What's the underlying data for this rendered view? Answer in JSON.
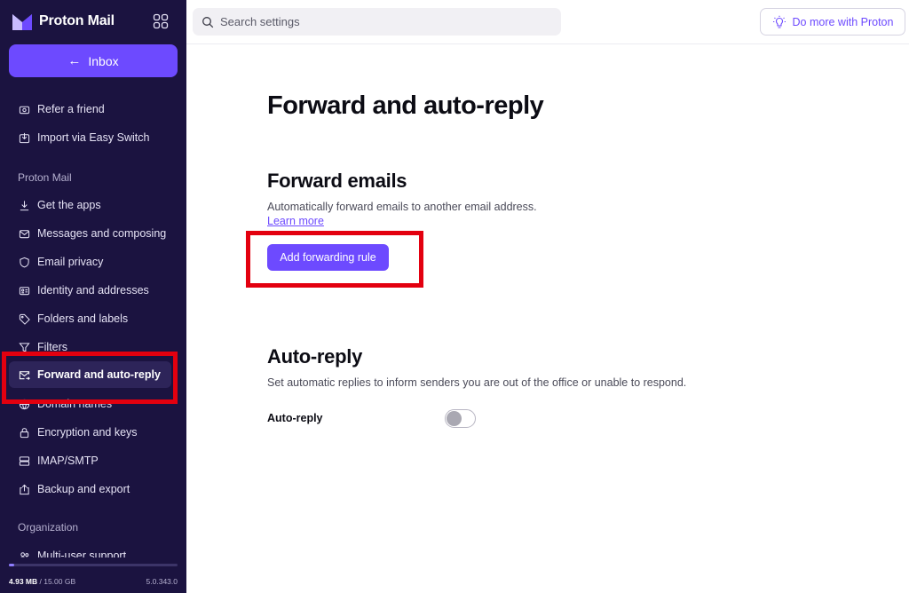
{
  "app": {
    "brand": "Proton Mail"
  },
  "sidebar": {
    "inbox_label": "Inbox",
    "items": [
      {
        "label": "Refer a friend",
        "icon": "gift-icon"
      },
      {
        "label": "Import via Easy Switch",
        "icon": "import-icon"
      }
    ],
    "section_mail": "Proton Mail",
    "mail_items": [
      {
        "label": "Get the apps",
        "icon": "download-icon"
      },
      {
        "label": "Messages and composing",
        "icon": "envelope-icon"
      },
      {
        "label": "Email privacy",
        "icon": "shield-icon"
      },
      {
        "label": "Identity and addresses",
        "icon": "id-card-icon"
      },
      {
        "label": "Folders and labels",
        "icon": "tag-icon"
      },
      {
        "label": "Filters",
        "icon": "filter-icon"
      },
      {
        "label": "Forward and auto-reply",
        "icon": "forward-envelope-icon",
        "active": true
      },
      {
        "label": "Domain names",
        "icon": "globe-icon"
      },
      {
        "label": "Encryption and keys",
        "icon": "lock-icon"
      },
      {
        "label": "IMAP/SMTP",
        "icon": "server-icon"
      },
      {
        "label": "Backup and export",
        "icon": "export-icon"
      }
    ],
    "section_org": "Organization",
    "org_items": [
      {
        "label": "Multi-user support",
        "icon": "users-icon"
      }
    ],
    "storage_used": "4.93 MB",
    "storage_total": "/ 15.00 GB",
    "storage_fraction": 0.003,
    "version": "5.0.343.0"
  },
  "topbar": {
    "search_placeholder": "Search settings",
    "do_more_label": "Do more with Proton"
  },
  "main": {
    "page_title": "Forward and auto-reply",
    "forward": {
      "title": "Forward emails",
      "description": "Automatically forward emails to another email address.",
      "learn_more": "Learn more",
      "add_button": "Add forwarding rule"
    },
    "autoreply": {
      "title": "Auto-reply",
      "description": "Set automatic replies to inform senders you are out of the office or unable to respond.",
      "toggle_label": "Auto-reply",
      "toggle_on": false
    }
  },
  "colors": {
    "sidebar_bg": "#1b1340",
    "accent": "#6d4aff",
    "highlight": "#e3000f"
  }
}
